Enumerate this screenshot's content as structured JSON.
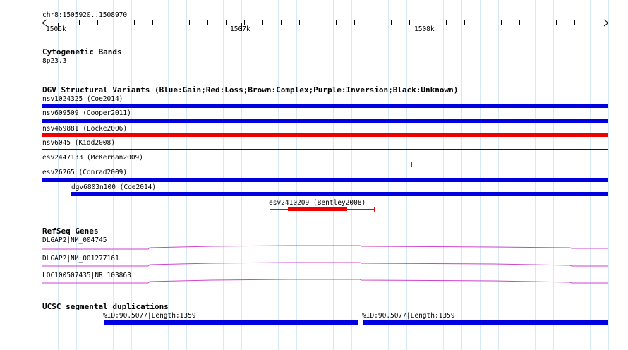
{
  "ruler": {
    "location": "chr8:1505920..1508970",
    "ticks": [
      "1506k",
      "1507k",
      "1508k"
    ]
  },
  "tracks": {
    "cytoband": {
      "title": "Cytogenetic Bands",
      "band": "8p23.3"
    },
    "dgv": {
      "title": "DGV Structural Variants (Blue:Gain;Red:Loss;Brown:Complex;Purple:Inversion;Black:Unknown)",
      "colors": {
        "gain": "#0000e0",
        "loss": "#ee0000"
      },
      "features": [
        {
          "label": "nsv1024325 (Coe2014)",
          "type": "gain"
        },
        {
          "label": "nsv609509 (Cooper2011)",
          "type": "gain"
        },
        {
          "label": "nsv469881 (Locke2006)",
          "type": "loss"
        },
        {
          "label": "nsv6045 (Kidd2008)",
          "type": "gain"
        },
        {
          "label": "esv2447133 (McKernan2009)",
          "type": "loss"
        },
        {
          "label": "esv26265 (Conrad2009)",
          "type": "gain"
        },
        {
          "label": "dgv6803n100 (Coe2014)",
          "type": "gain"
        },
        {
          "label": "esv2410209 (Bentley2008)",
          "type": "loss"
        }
      ]
    },
    "refseq": {
      "title": "RefSeq Genes",
      "color": "#cc44cc",
      "genes": [
        {
          "label": "DLGAP2|NM_004745"
        },
        {
          "label": "DLGAP2|NM_001277161"
        },
        {
          "label": "LOC100507435|NR_103863"
        }
      ]
    },
    "segdup": {
      "title": "UCSC segmental duplications",
      "features": [
        {
          "label": "%ID:90.5077|Length:1359"
        },
        {
          "label": "%ID:90.5077|Length:1359"
        }
      ]
    }
  }
}
